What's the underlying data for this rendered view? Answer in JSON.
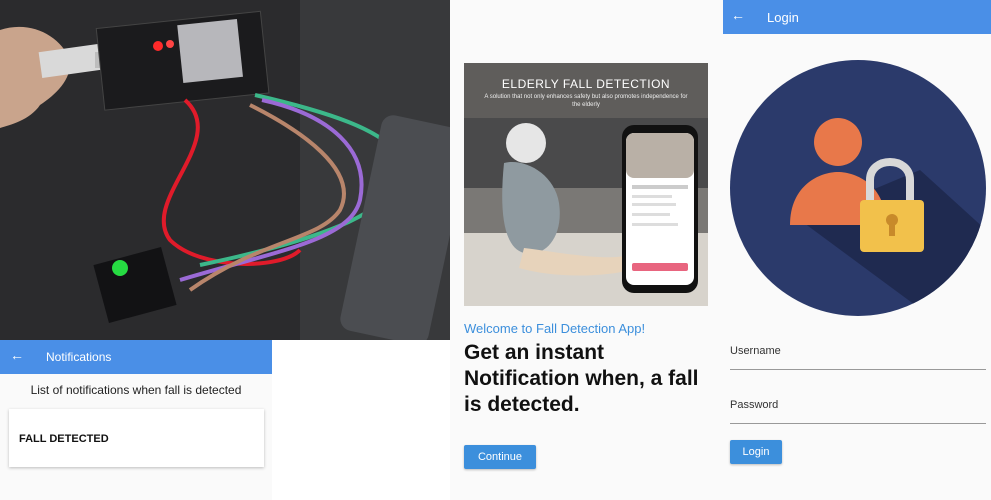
{
  "notifications": {
    "back_icon": "arrow-left-icon",
    "title": "Notifications",
    "subtitle": "List of notifications when fall is detected",
    "items": [
      {
        "label": "FALL DETECTED"
      }
    ]
  },
  "welcome": {
    "hero_title": "ELDERLY FALL DETECTION",
    "hero_subtitle": "A solution that not only enhances safety but also promotes independence for the elderly",
    "line1": "Welcome to Fall Detection App!",
    "line2": "Get an instant Notification when, a fall is detected.",
    "continue_label": "Continue"
  },
  "login": {
    "back_icon": "arrow-left-icon",
    "title": "Login",
    "username_label": "Username",
    "password_label": "Password",
    "login_label": "Login"
  },
  "colors": {
    "appbar": "#4a8fe7",
    "accent": "#3c8fdc",
    "avatar_circle": "#2b3a6b",
    "person": "#e8784a",
    "lock": "#f2c14b"
  }
}
